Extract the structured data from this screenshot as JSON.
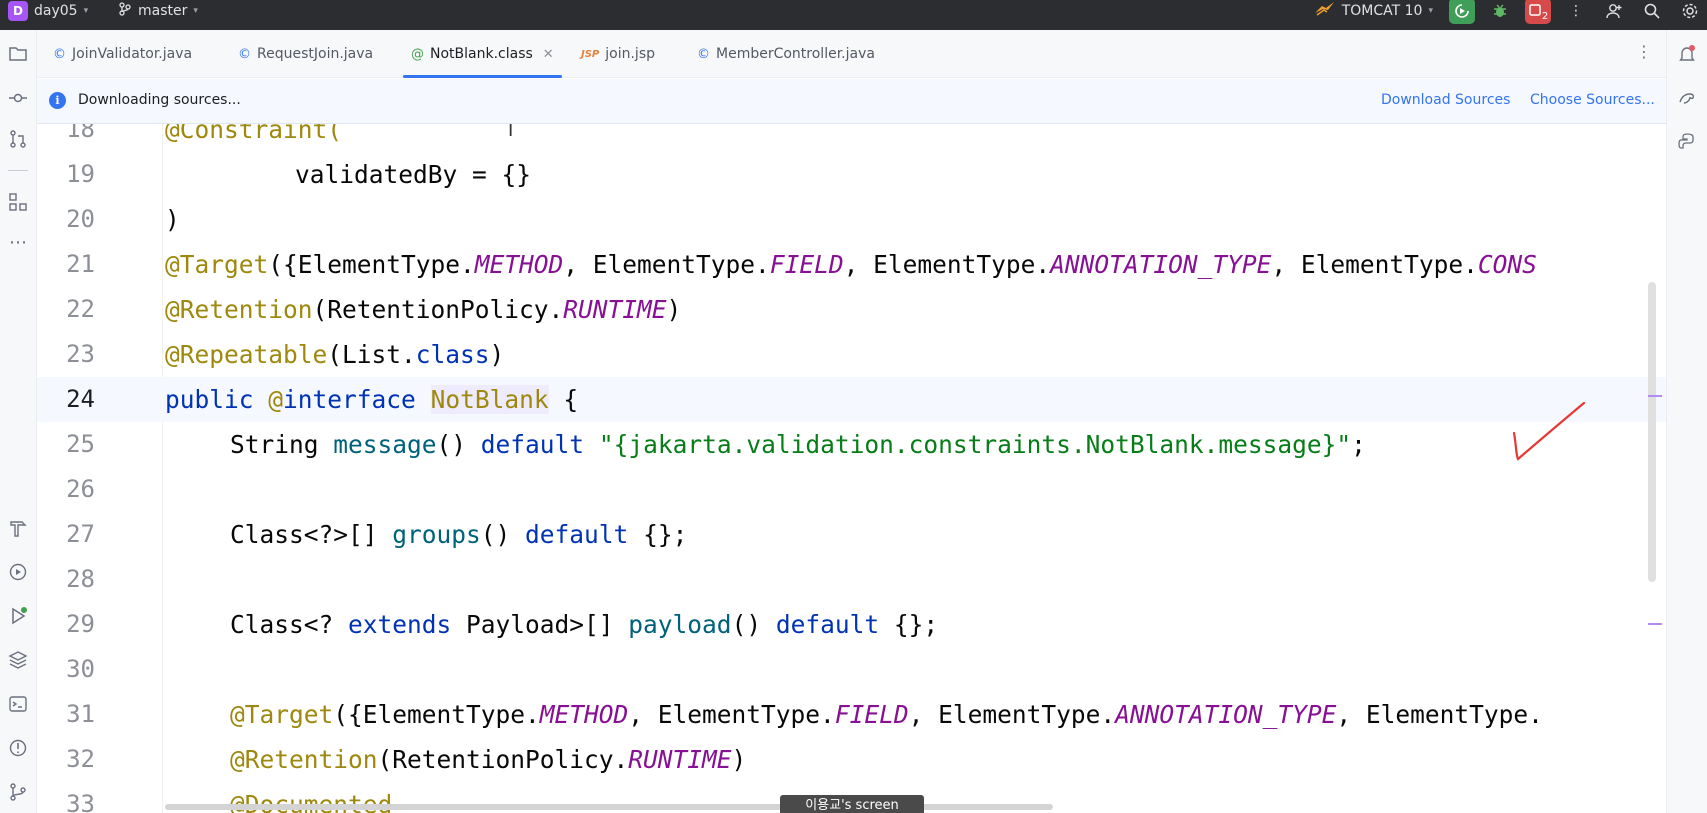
{
  "titlebar": {
    "project_badge": "D",
    "project_name": "day05",
    "branch_name": "master",
    "run_config": "TOMCAT 10",
    "notification_count": "2"
  },
  "tabs": [
    {
      "label": "JoinValidator.java",
      "icon": "class-icon",
      "active": false
    },
    {
      "label": "RequestJoin.java",
      "icon": "class-icon",
      "active": false
    },
    {
      "label": "NotBlank.class",
      "icon": "annotation-icon",
      "active": true
    },
    {
      "label": "join.jsp",
      "icon": "jsp-icon",
      "active": false
    },
    {
      "label": "MemberController.java",
      "icon": "class-icon",
      "active": false
    }
  ],
  "banner": {
    "message": "Downloading sources...",
    "download_sources": "Download Sources",
    "choose_sources": "Choose Sources..."
  },
  "editor": {
    "current_line": 24,
    "lines": [
      {
        "n": "18",
        "text": "@Constraint("
      },
      {
        "n": "19",
        "text": "validatedBy = {}"
      },
      {
        "n": "20",
        "text": ")"
      },
      {
        "n": "21",
        "text": "@Target({ElementType.METHOD, ElementType.FIELD, ElementType.ANNOTATION_TYPE, ElementType.CONS"
      },
      {
        "n": "22",
        "text": "@Retention(RetentionPolicy.RUNTIME)"
      },
      {
        "n": "23",
        "text": "@Repeatable(List.class)"
      },
      {
        "n": "24",
        "text": "public @interface NotBlank {"
      },
      {
        "n": "25",
        "text": "String message() default \"{jakarta.validation.constraints.NotBlank.message}\";"
      },
      {
        "n": "26",
        "text": ""
      },
      {
        "n": "27",
        "text": "Class<?>[] groups() default {};"
      },
      {
        "n": "28",
        "text": ""
      },
      {
        "n": "29",
        "text": "Class<? extends Payload>[] payload() default {};"
      },
      {
        "n": "30",
        "text": ""
      },
      {
        "n": "31",
        "text": "@Target({ElementType.METHOD, ElementType.FIELD, ElementType.ANNOTATION_TYPE, ElementType."
      },
      {
        "n": "32",
        "text": "@Retention(RetentionPolicy.RUNTIME)"
      },
      {
        "n": "33",
        "text": "@Documented"
      }
    ]
  },
  "overlay": {
    "screen_share_label": "이용교's screen"
  },
  "colors": {
    "accent": "#3574f0",
    "annotation": "#9e880d",
    "keyword": "#0033b3",
    "constant": "#871094",
    "method": "#00627a",
    "string": "#067d17",
    "hand_mark": "#e53935"
  }
}
